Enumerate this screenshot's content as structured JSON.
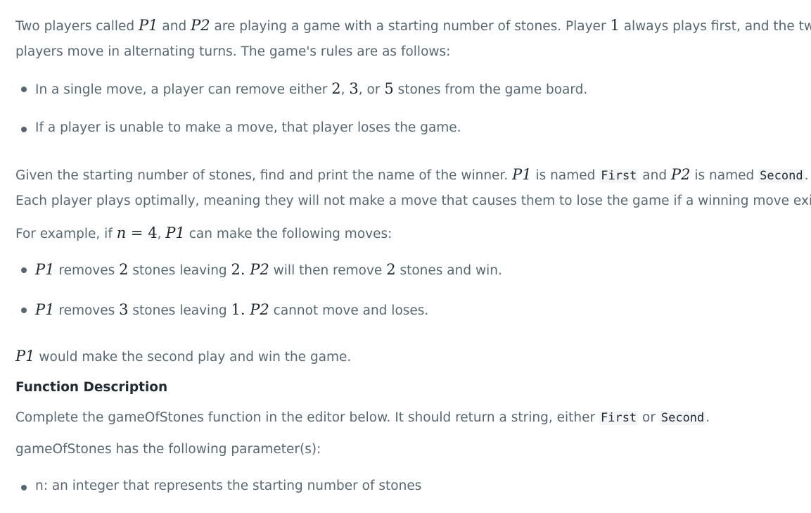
{
  "intro": {
    "s1": "Two players called ",
    "p1": "P1",
    "s2": " and ",
    "p2": "P2",
    "s3": " are playing a game with a starting number of stones. Player ",
    "one": "1",
    "s4": " always plays first, and the two",
    "line2": "players move in alternating turns. The game's rules are as follows:"
  },
  "rules": {
    "r1_a": "In a single move, a player can remove either ",
    "r1_n1": "2",
    "r1_c1": ", ",
    "r1_n2": "3",
    "r1_c2": ", or ",
    "r1_n3": "5",
    "r1_b": " stones from the game board.",
    "r2": "If a player is unable to make a move, that player loses the game."
  },
  "given": {
    "a": "Given the starting number of stones, find and print the name of the winner. ",
    "p1": "P1",
    "b": " is named ",
    "first": "First",
    "c": " and ",
    "p2": "P2",
    "d": " is named ",
    "second": "Second",
    "e": ".",
    "line2": "Each player plays optimally, meaning they will not make a move that causes them to lose the game if a winning move exists."
  },
  "example": {
    "a": "For example, if ",
    "n": "n",
    "eq": " = ",
    "four": "4",
    "comma": ", ",
    "p1": "P1",
    "b": " can make the following moves:"
  },
  "moves": {
    "m1_p1": "P1",
    "m1_a": " removes ",
    "m1_two": "2",
    "m1_b": " stones leaving ",
    "m1_two2": "2",
    "m1_dot": ". ",
    "m1_p2": "P2",
    "m1_c": " will then remove ",
    "m1_two3": "2",
    "m1_d": " stones and win.",
    "m2_p1": "P1",
    "m2_a": " removes ",
    "m2_three": "3",
    "m2_b": " stones leaving ",
    "m2_one": "1",
    "m2_dot": ". ",
    "m2_p2": "P2",
    "m2_c": " cannot move and loses."
  },
  "conclusion": {
    "p1": "P1",
    "text": " would make the second play and win the game."
  },
  "function_heading": "Function Description",
  "complete": {
    "a": "Complete the gameOfStones function in the editor below. It should return a string, either ",
    "first": "First",
    "b": " or ",
    "second": "Second",
    "c": "."
  },
  "params_intro": "gameOfStones has the following parameter(s):",
  "param_n": "n: an integer that represents the starting number of stones"
}
